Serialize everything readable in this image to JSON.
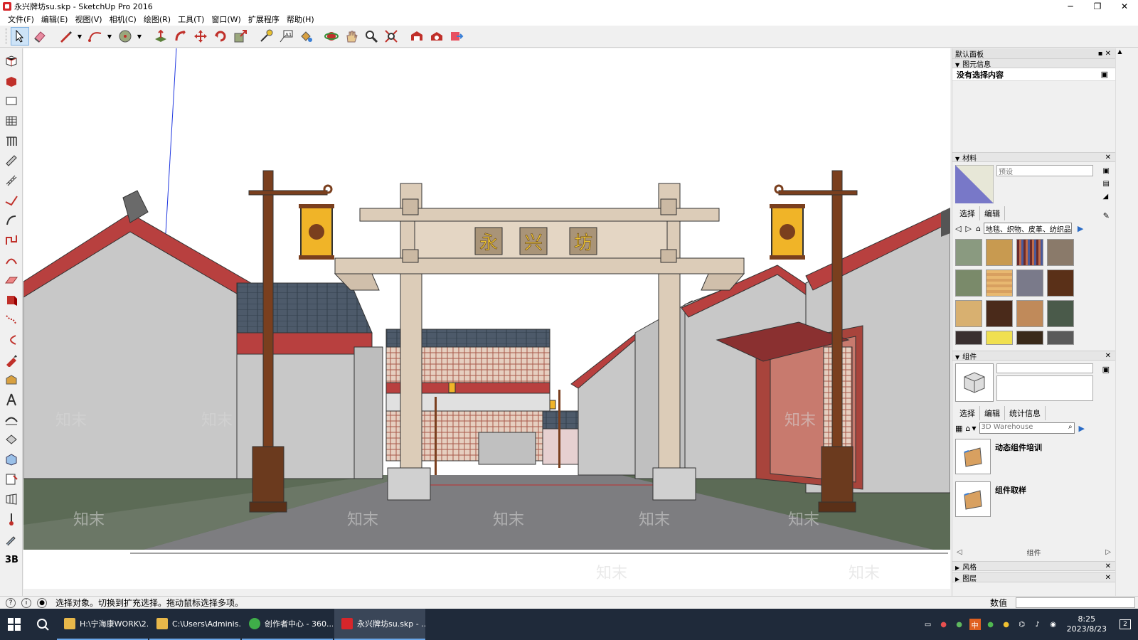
{
  "window": {
    "title": "永兴牌坊su.skp - SketchUp Pro 2016",
    "minimize": "─",
    "maximize": "❐",
    "close": "✕"
  },
  "menu": [
    "文件(F)",
    "编辑(E)",
    "视图(V)",
    "相机(C)",
    "绘图(R)",
    "工具(T)",
    "窗口(W)",
    "扩展程序",
    "帮助(H)"
  ],
  "scene": {
    "gate_text": [
      "永",
      "兴",
      "坊"
    ],
    "watermark": "知末"
  },
  "tray": {
    "title": "默认面板",
    "entity_info": {
      "header": "图元信息",
      "value": "没有选择内容"
    },
    "materials": {
      "header": "材料",
      "name_placeholder": "预设",
      "tabs": [
        "选择",
        "编辑"
      ],
      "category": "地毯、织物、皮革、纺织品"
    },
    "components": {
      "header": "组件",
      "tabs": [
        "选择",
        "编辑",
        "统计信息"
      ],
      "search_placeholder": "3D Warehouse",
      "items": [
        "动态组件培训",
        "组件取样"
      ],
      "footer": "组件"
    },
    "styles": {
      "header": "风格"
    },
    "layers": {
      "header": "图层"
    }
  },
  "status": {
    "hint": "选择对象。切换到扩充选择。拖动鼠标选择多项。",
    "measure_label": "数值"
  },
  "taskbar": {
    "apps": [
      {
        "label": "H:\\宁海康WORK\\2...",
        "color": "#e8b84a"
      },
      {
        "label": "C:\\Users\\Adminis...",
        "color": "#e8b84a"
      },
      {
        "label": "创作者中心 - 360...",
        "color": "#3fae49"
      },
      {
        "label": "永兴牌坊su.skp - ...",
        "color": "#d6262b"
      }
    ],
    "time": "8:25",
    "date": "2023/8/23",
    "ime": "中",
    "notifications": "2"
  },
  "colors": {
    "wall": "#c8c8c8",
    "roof_trim": "#b8403f",
    "timber": "#dcccb8",
    "lantern": "#f0b428",
    "pole": "#7a3f1e",
    "ground": "#5c6b56",
    "road": "#7d7d80"
  }
}
